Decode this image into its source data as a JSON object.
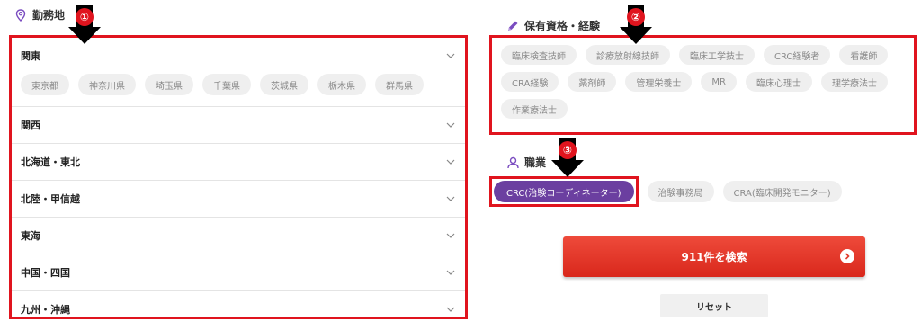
{
  "work_location": {
    "title": "勤務地",
    "regions": [
      {
        "label": "関東",
        "expanded": true,
        "prefectures": [
          "東京都",
          "神奈川県",
          "埼玉県",
          "千葉県",
          "茨城県",
          "栃木県",
          "群馬県"
        ]
      },
      {
        "label": "関西"
      },
      {
        "label": "北海道・東北"
      },
      {
        "label": "北陸・甲信越"
      },
      {
        "label": "東海"
      },
      {
        "label": "中国・四国"
      },
      {
        "label": "九州・沖縄"
      }
    ]
  },
  "qualifications": {
    "title": "保有資格・経験",
    "items": [
      "臨床検査技師",
      "診療放射線技師",
      "臨床工学技士",
      "CRC経験者",
      "看護師",
      "CRA経験",
      "薬剤師",
      "管理栄養士",
      "MR",
      "臨床心理士",
      "理学療法士",
      "作業療法士"
    ]
  },
  "job_type": {
    "title": "職業",
    "items": [
      "CRC(治験コーディネーター)",
      "治験事務局",
      "CRA(臨床開発モニター)"
    ]
  },
  "actions": {
    "search_label": "911件を検索",
    "reset_label": "リセット"
  },
  "annotations": [
    "①",
    "②",
    "③"
  ],
  "colors": {
    "highlight": "#e0141e",
    "accent": "#6b3fa0",
    "search": "#e03a2c"
  }
}
